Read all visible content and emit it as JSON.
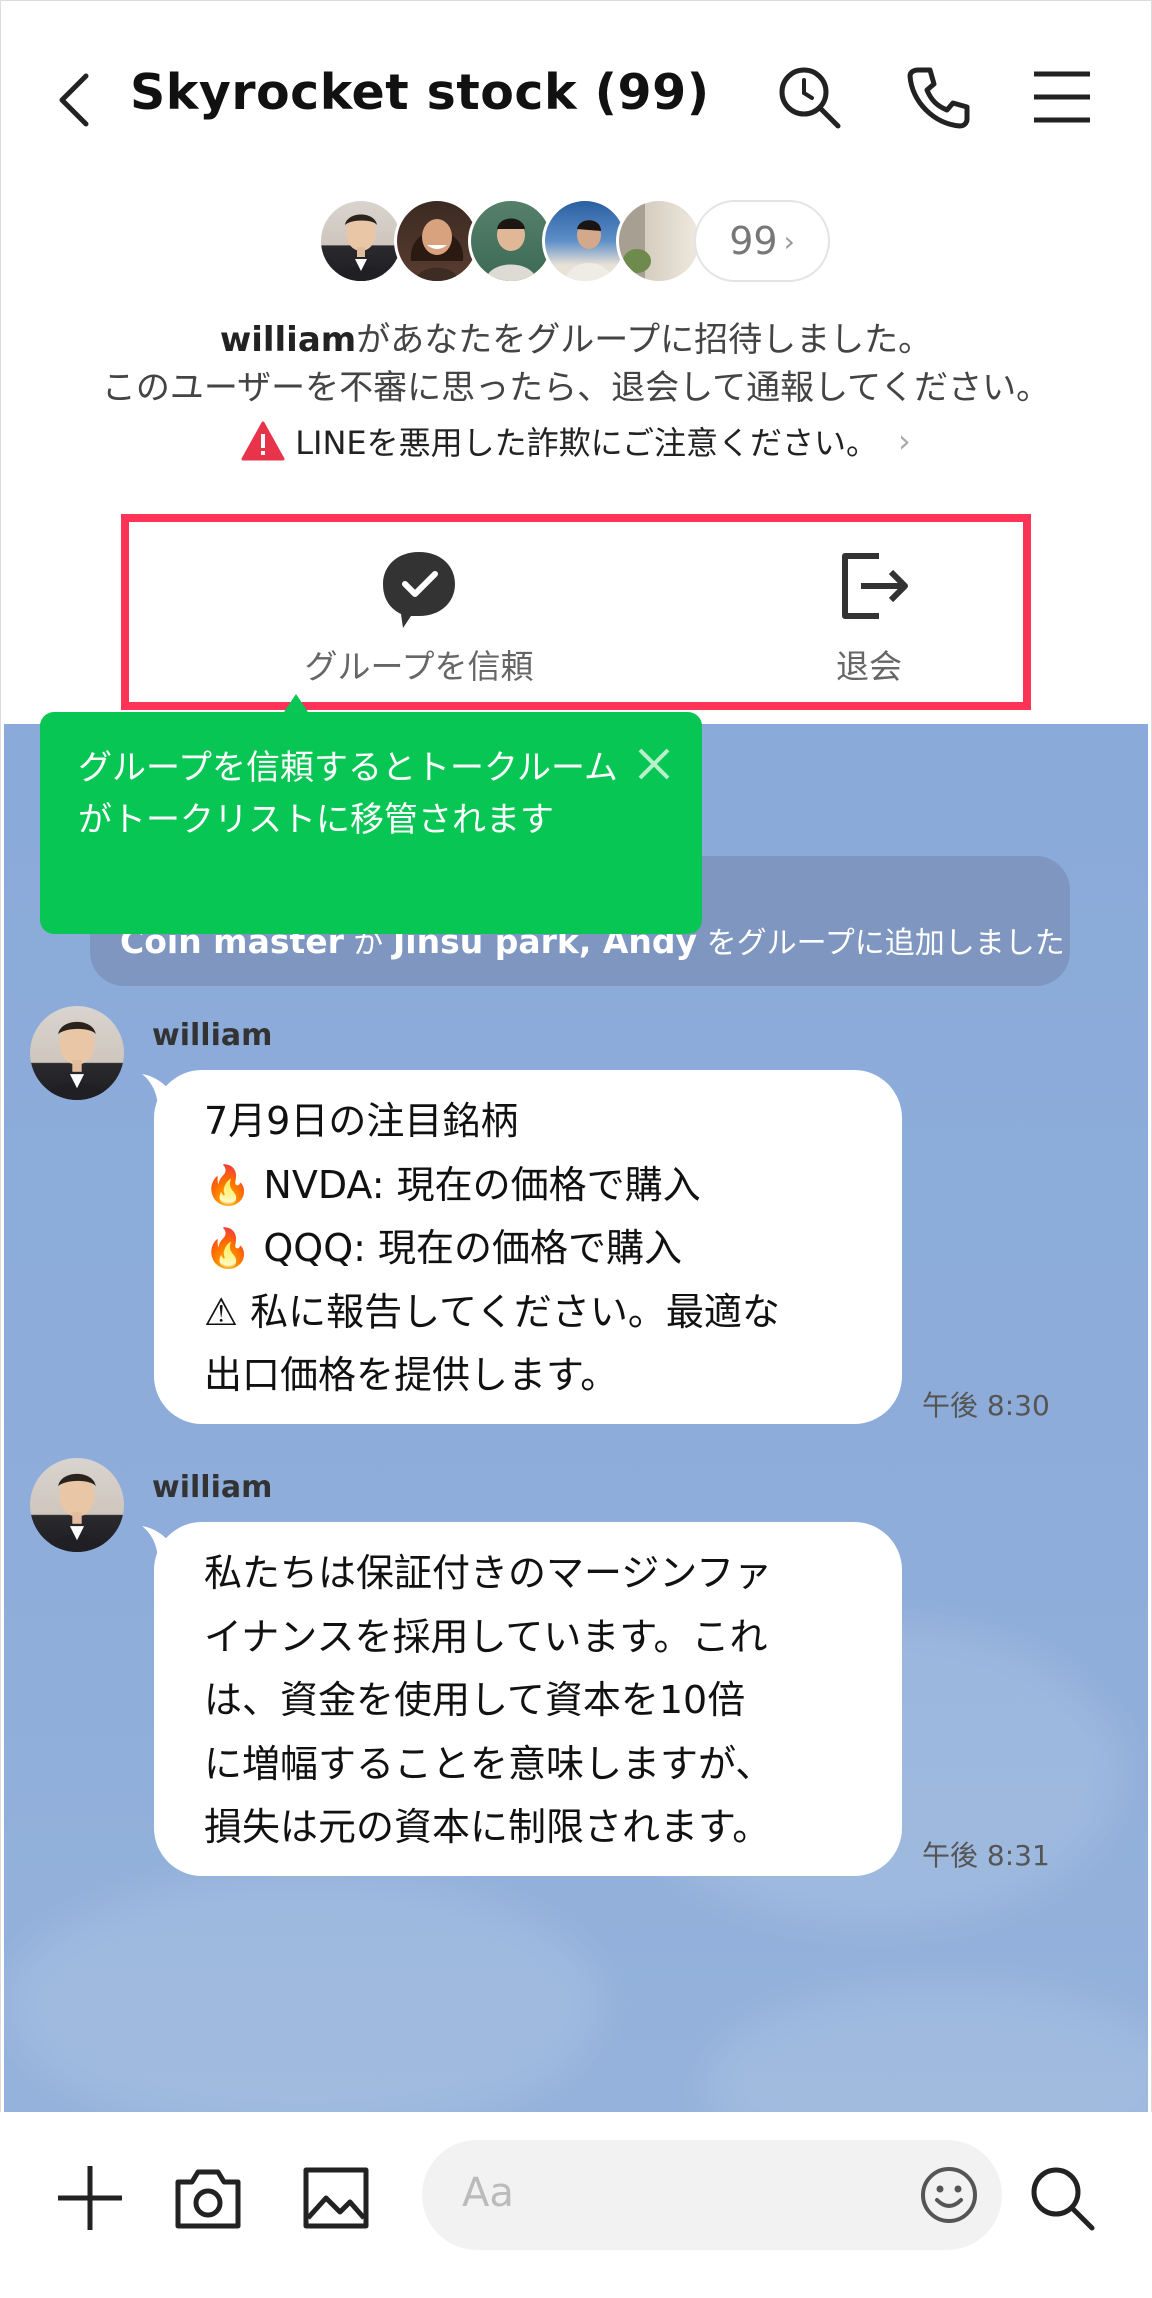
{
  "header": {
    "title": "Skyrocket stock (99)",
    "icons": [
      "back-arrow-icon",
      "search-icon",
      "phone-icon",
      "menu-icon"
    ]
  },
  "group_info": {
    "member_count": "99",
    "invite_user": "william",
    "invite_text": "があなたをグループに招待しました。",
    "warning_text": "このユーザーを不審に思ったら、退会して通報してください。",
    "fraud_warning": "LINEを悪用した詐欺にご注意ください。"
  },
  "actions": {
    "trust_label": "グループを信頼",
    "leave_label": "退会"
  },
  "tooltip": {
    "text": "グループを信頼するとトークルームがトークリストに移管されます"
  },
  "system_message": {
    "actor": "Coin master",
    "particle": "が",
    "targets": "Jinsu park, Andy",
    "suffix": "をグループに追加しました"
  },
  "messages": [
    {
      "sender": "william",
      "lines": [
        "7月9日の注目銘柄",
        "🔥 NVDA: 現在の価格で購入",
        "🔥 QQQ: 現在の価格で購入",
        "⚠ 私に報告してください。最適な",
        "出口価格を提供します。"
      ],
      "time": "午後 8:30"
    },
    {
      "sender": "william",
      "lines": [
        "私たちは保証付きのマージンファ",
        "イナンスを採用しています。これ",
        "は、資金を使用して資本を10倍",
        "に増幅することを意味しますが、",
        "損失は元の資本に制限されます。"
      ],
      "time": "午後 8:31"
    }
  ],
  "input": {
    "placeholder": "Aa"
  },
  "colors": {
    "highlight_box": "#ff3355",
    "tooltip_bg": "#07c654",
    "chat_bg": "#8aaad9",
    "warning_red": "#e8344a"
  }
}
